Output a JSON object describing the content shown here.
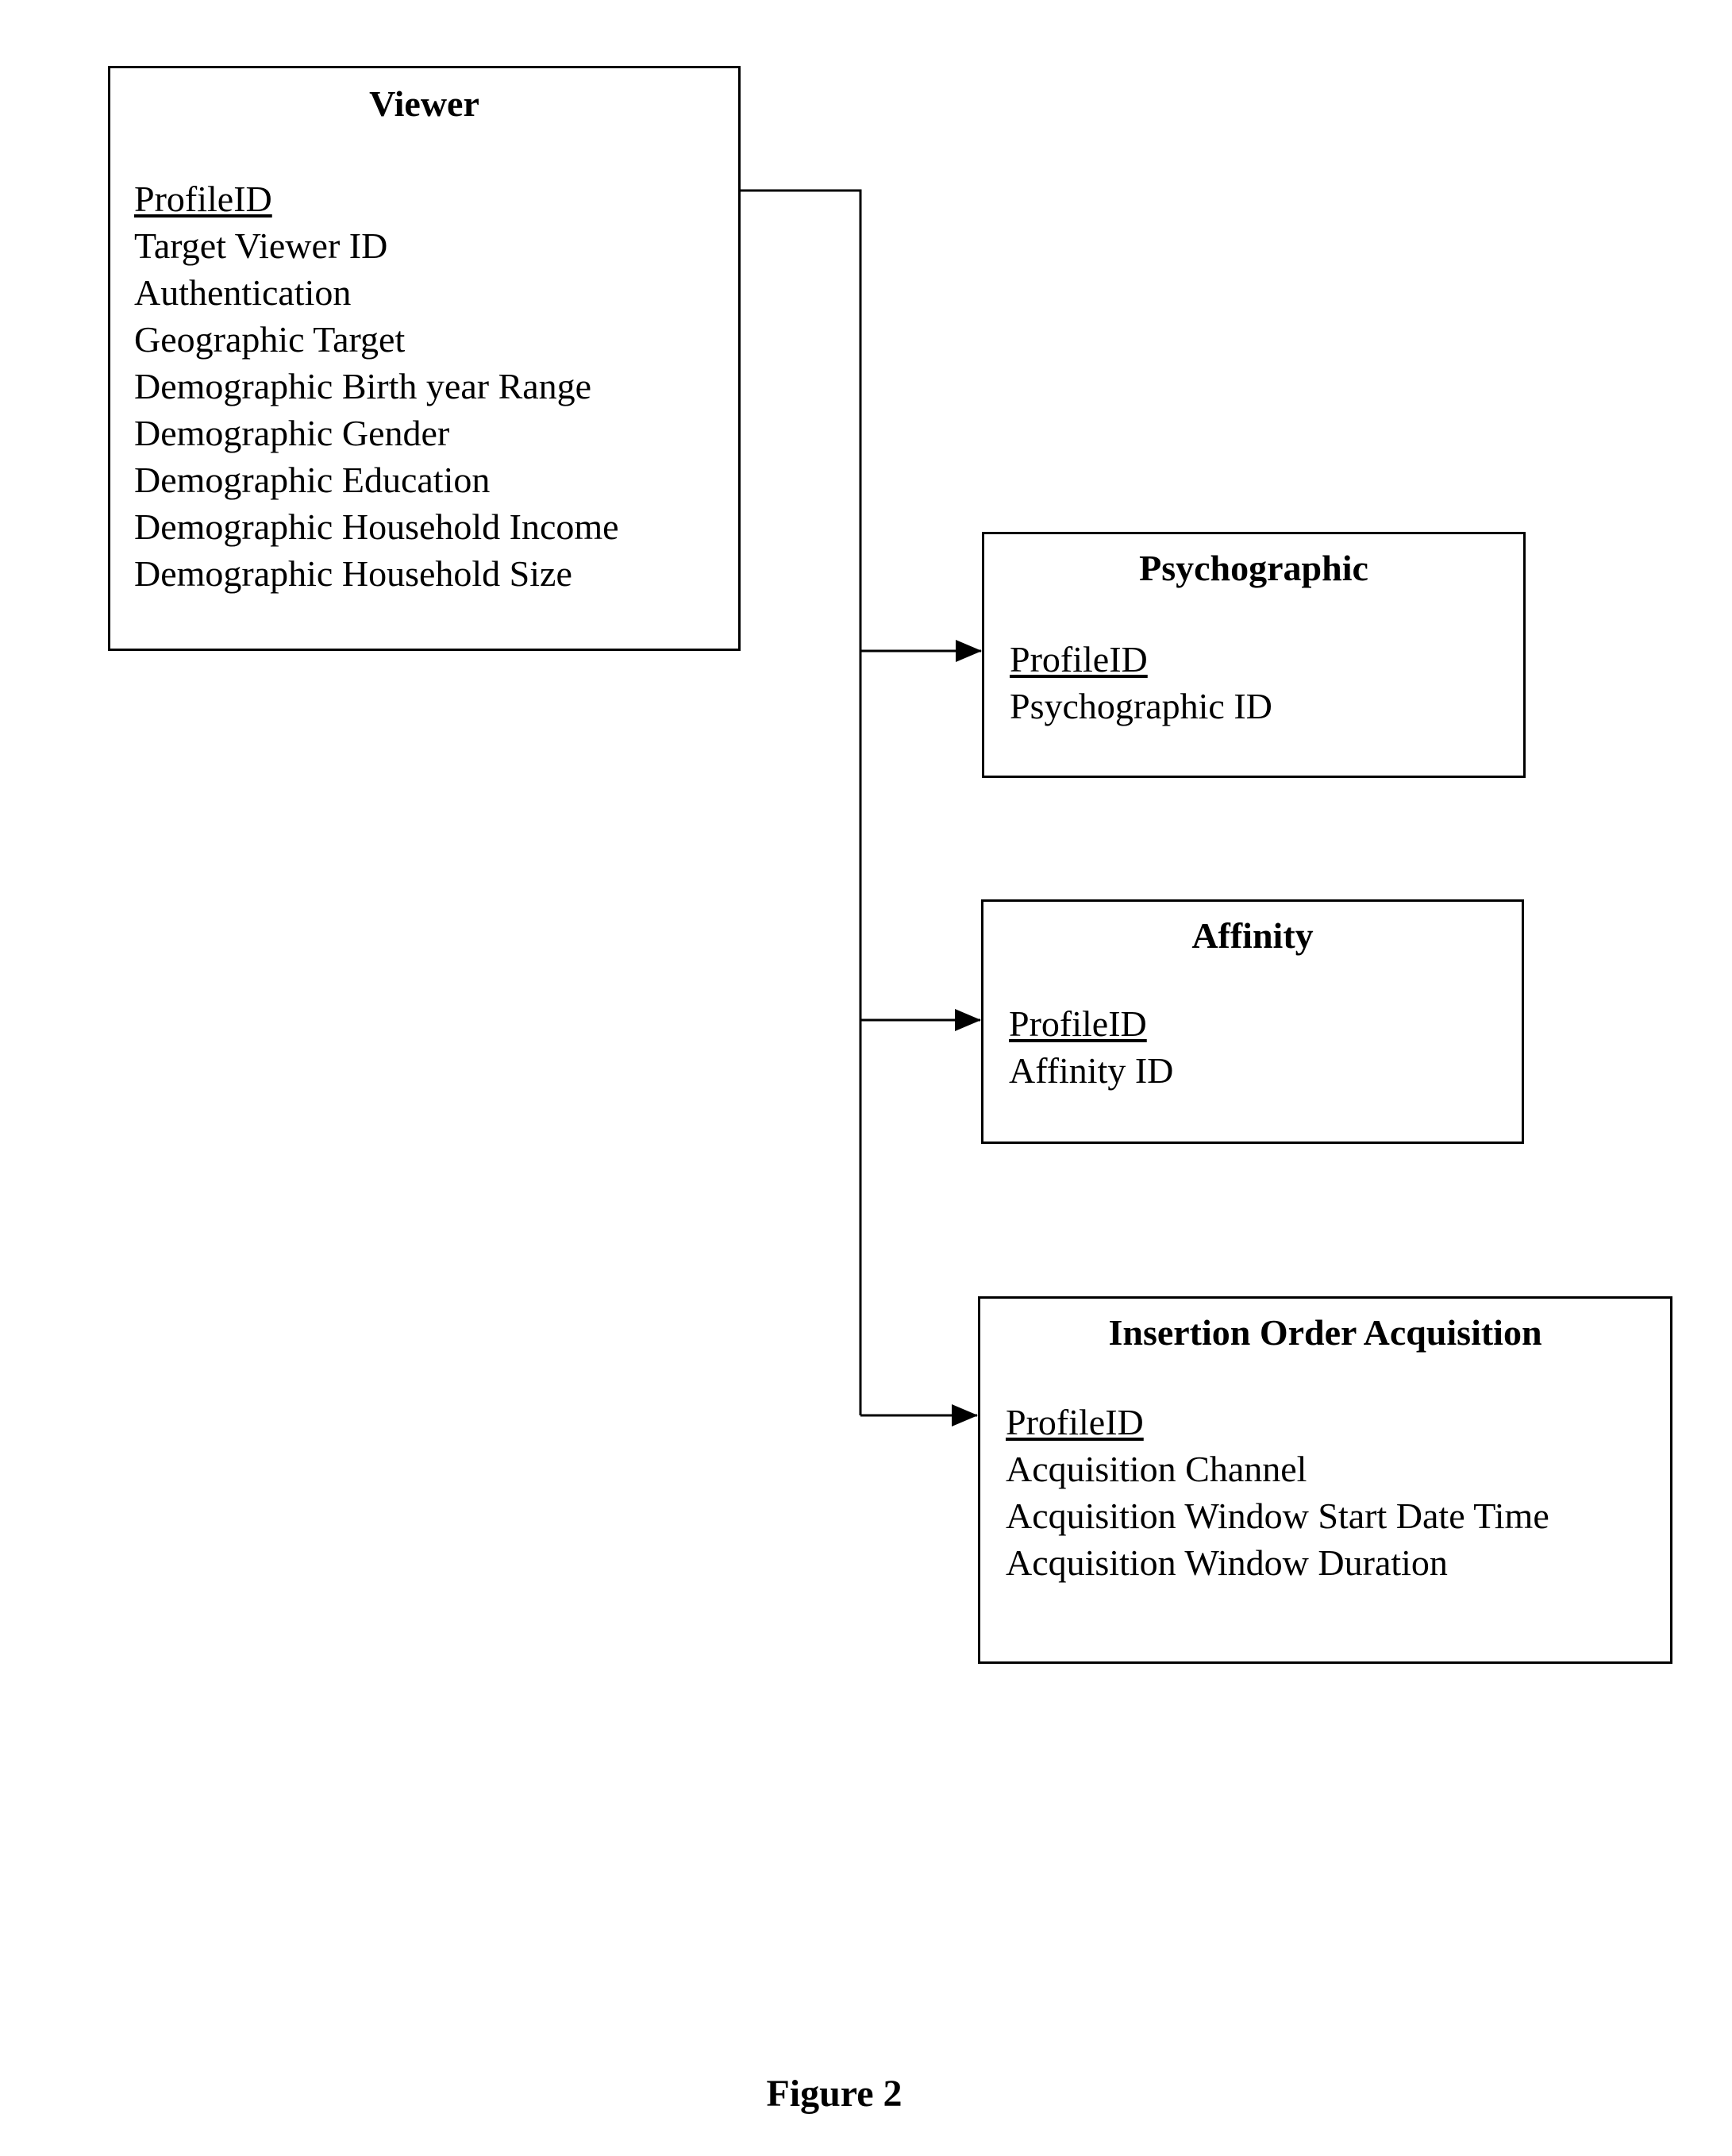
{
  "entities": {
    "viewer": {
      "title": "Viewer",
      "primary_key": "ProfileID",
      "fields": [
        "Target Viewer ID",
        "Authentication",
        "Geographic Target",
        "Demographic Birth year Range",
        "Demographic Gender",
        "Demographic Education",
        "Demographic Household Income",
        "Demographic Household Size"
      ]
    },
    "psychographic": {
      "title": "Psychographic",
      "primary_key": "ProfileID",
      "fields": [
        "Psychographic ID"
      ]
    },
    "affinity": {
      "title": "Affinity",
      "primary_key": "ProfileID",
      "fields": [
        "Affinity ID"
      ]
    },
    "insertion_order_acquisition": {
      "title": "Insertion Order Acquisition",
      "primary_key": "ProfileID",
      "fields": [
        "Acquisition Channel",
        "Acquisition Window Start Date Time",
        "Acquisition Window Duration"
      ]
    }
  },
  "relationships": [
    {
      "from": "Viewer",
      "to": "Psychographic"
    },
    {
      "from": "Viewer",
      "to": "Affinity"
    },
    {
      "from": "Viewer",
      "to": "Insertion Order Acquisition"
    }
  ],
  "caption": "Figure 2"
}
